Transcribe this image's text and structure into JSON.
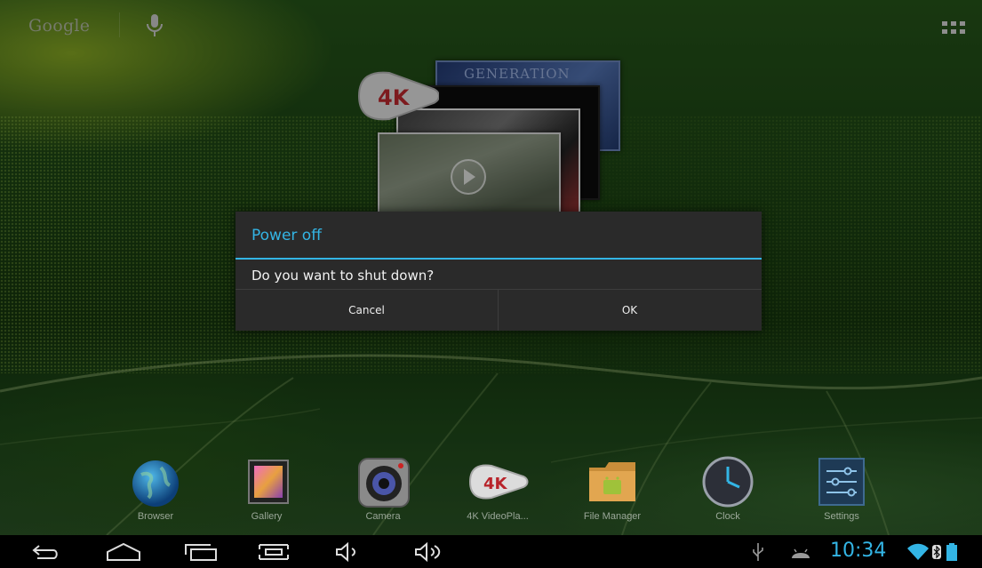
{
  "search": {
    "brand": "Google"
  },
  "widget": {
    "badge": "4K",
    "card_title": "GENERATION"
  },
  "dialog": {
    "title": "Power off",
    "message": "Do you want to shut down?",
    "cancel_label": "Cancel",
    "ok_label": "OK"
  },
  "dock": {
    "apps": [
      {
        "label": "Browser",
        "icon": "globe-icon"
      },
      {
        "label": "Gallery",
        "icon": "gallery-icon"
      },
      {
        "label": "Camera",
        "icon": "camera-icon"
      },
      {
        "label": "4K VideoPla...",
        "icon": "4k-video-icon"
      },
      {
        "label": "File Manager",
        "icon": "folder-icon"
      },
      {
        "label": "Clock",
        "icon": "clock-icon"
      },
      {
        "label": "Settings",
        "icon": "settings-icon"
      }
    ]
  },
  "status": {
    "time": "10:34"
  },
  "colors": {
    "accent": "#33b5e5",
    "dialog_bg": "#2a2a2a",
    "navbar_bg": "#000000"
  }
}
